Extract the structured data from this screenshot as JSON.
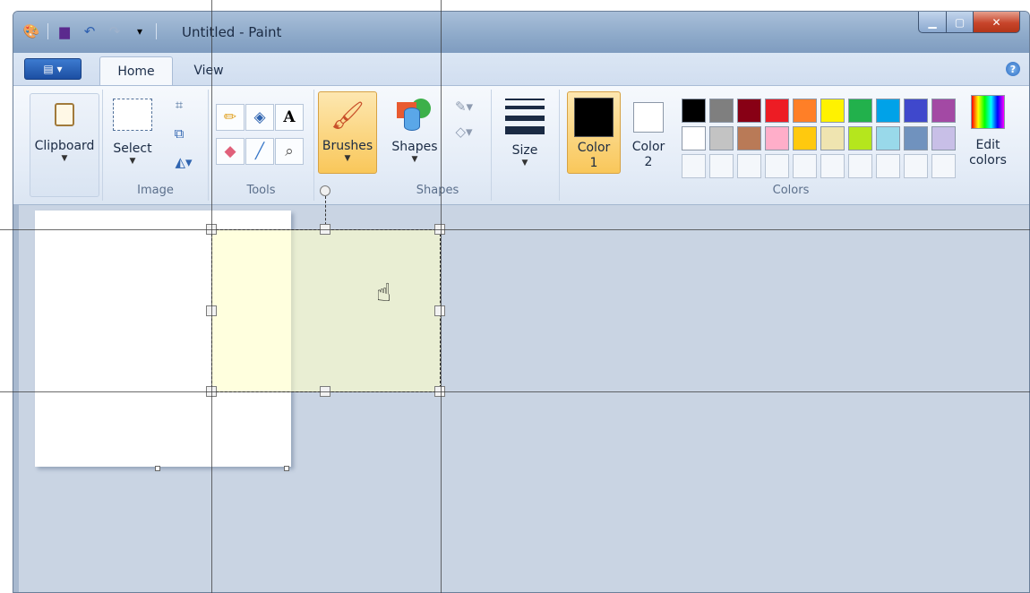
{
  "window": {
    "title": "Untitled - Paint"
  },
  "qat": {
    "icons": [
      "paint-app-icon",
      "save-icon",
      "undo-icon",
      "redo-icon",
      "customize-qat-icon"
    ]
  },
  "tabs": {
    "file_label": "▤ ▾",
    "home": "Home",
    "view": "View",
    "help": "?"
  },
  "clipboard": {
    "label": "Clipboard",
    "group": ""
  },
  "image": {
    "select_label": "Select",
    "group": "Image"
  },
  "tools": {
    "group": "Tools"
  },
  "brushes": {
    "label": "Brushes"
  },
  "shapes": {
    "label": "Shapes",
    "group": "Shapes"
  },
  "size": {
    "label": "Size"
  },
  "colors": {
    "color1_label": "Color",
    "color1_num": "1",
    "color2_label": "Color",
    "color2_num": "2",
    "edit_label": "Edit",
    "edit_label2": "colors",
    "group": "Colors",
    "color1": "#000000",
    "color2": "#ffffff",
    "row1": [
      "#000000",
      "#7f7f7f",
      "#880015",
      "#ed1c24",
      "#ff7f27",
      "#fff200",
      "#22b14c",
      "#00a2e8",
      "#3f48cc",
      "#a349a4"
    ],
    "row2": [
      "#ffffff",
      "#c3c3c3",
      "#b97a57",
      "#ffaec9",
      "#ffc90e",
      "#efe4b0",
      "#b5e61d",
      "#99d9ea",
      "#7092be",
      "#c8bfe7"
    ]
  }
}
